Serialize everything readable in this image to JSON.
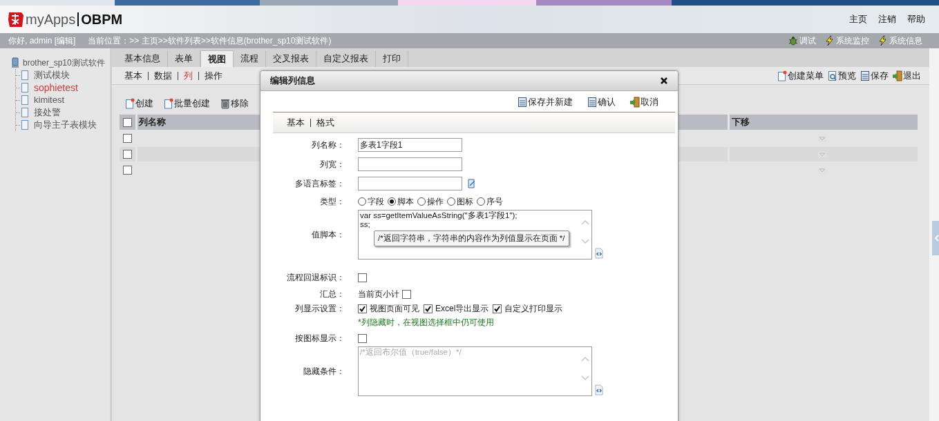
{
  "header": {
    "logo_text": "myApps",
    "product": "OBPM",
    "links": [
      "主页",
      "注销",
      "帮助"
    ]
  },
  "info_bar": {
    "greeting": "你好, admin [编辑]",
    "location": "当前位置：>> 主页>>软件列表>>软件信息(brother_sp10测试软件)",
    "tools": [
      {
        "label": "调试",
        "kind": "bug"
      },
      {
        "label": "系统监控",
        "kind": "bolt"
      },
      {
        "label": "系统信息",
        "kind": "bolt"
      }
    ]
  },
  "sidebar": {
    "tree": {
      "label": "brother_sp10测试软件",
      "children": [
        {
          "label": "测试模块",
          "selected": false
        },
        {
          "label": "sophietest",
          "selected": true
        },
        {
          "label": "kimitest",
          "selected": false
        },
        {
          "label": "接处警",
          "selected": false
        },
        {
          "label": "向导主子表模块",
          "selected": false
        }
      ]
    }
  },
  "tabs": [
    {
      "label": "基本信息",
      "selected": false
    },
    {
      "label": "表单",
      "selected": false
    },
    {
      "label": "视图",
      "selected": true
    },
    {
      "label": "流程",
      "selected": false
    },
    {
      "label": "交叉报表",
      "selected": false
    },
    {
      "label": "自定义报表",
      "selected": false
    },
    {
      "label": "打印",
      "selected": false
    }
  ],
  "sub_tabs": [
    {
      "label": "基本",
      "selected": false
    },
    {
      "label": "数据",
      "selected": false
    },
    {
      "label": "列",
      "selected": true
    },
    {
      "label": "操作",
      "selected": false
    }
  ],
  "toolbar": [
    {
      "label": "创建",
      "kind": "create"
    },
    {
      "label": "批量创建",
      "kind": "create"
    },
    {
      "label": "移除",
      "kind": "remove"
    }
  ],
  "page_actions": [
    {
      "label": "创建菜单",
      "kind": "create"
    },
    {
      "label": "预览",
      "kind": "preview"
    },
    {
      "label": "保存",
      "kind": "save"
    },
    {
      "label": "退出",
      "kind": "exit"
    }
  ],
  "table": {
    "header_checked": false,
    "columns": [
      "列名称",
      "下移"
    ],
    "rows": [
      {
        "checked": false
      },
      {
        "checked": false
      },
      {
        "checked": false
      }
    ]
  },
  "dialog": {
    "title": "编辑列信息",
    "buttons": [
      {
        "label": "保存并新建",
        "kind": "save"
      },
      {
        "label": "确认",
        "kind": "save"
      },
      {
        "label": "取消",
        "kind": "exit"
      }
    ],
    "tabs": [
      "基本",
      "格式"
    ],
    "fields": [
      {
        "kind": "text",
        "label": "列名称：",
        "value": "多表1字段1"
      },
      {
        "kind": "text",
        "label": "列宽："
      },
      {
        "kind": "text_icon",
        "label": "多语言标签："
      },
      {
        "kind": "radio",
        "label": "类型：",
        "options": [
          {
            "label": "字段",
            "selected": false
          },
          {
            "label": "脚本",
            "selected": true
          },
          {
            "label": "操作",
            "selected": false
          },
          {
            "label": "图标",
            "selected": false
          },
          {
            "label": "序号",
            "selected": false
          }
        ]
      },
      {
        "kind": "script",
        "label": "值脚本：",
        "value": "var ss=getItemValueAsString(\"多表1字段1\");\nss;",
        "tooltip": "/*返回字符串，字符串的内容作为列值显示在页面 */"
      },
      {
        "kind": "checkbox",
        "label": "流程回退标识：",
        "checked": false
      },
      {
        "kind": "checkbox",
        "label": "汇总：",
        "text": "当前页小计",
        "checked": false
      },
      {
        "kind": "checkgroup",
        "label": "列显示设置：",
        "options": [
          {
            "label": "视图页面可见",
            "checked": true
          },
          {
            "label": "Excel导出显示",
            "checked": true
          },
          {
            "label": "自定义打印显示",
            "checked": true
          }
        ],
        "note": "*列隐藏时，在视图选择框中仍可使用"
      },
      {
        "kind": "checkbox",
        "label": "按图标显示：",
        "checked": false
      },
      {
        "kind": "script",
        "label": "隐藏条件：",
        "placeholder": "/*返回布尔值（true/false）*/"
      }
    ]
  }
}
